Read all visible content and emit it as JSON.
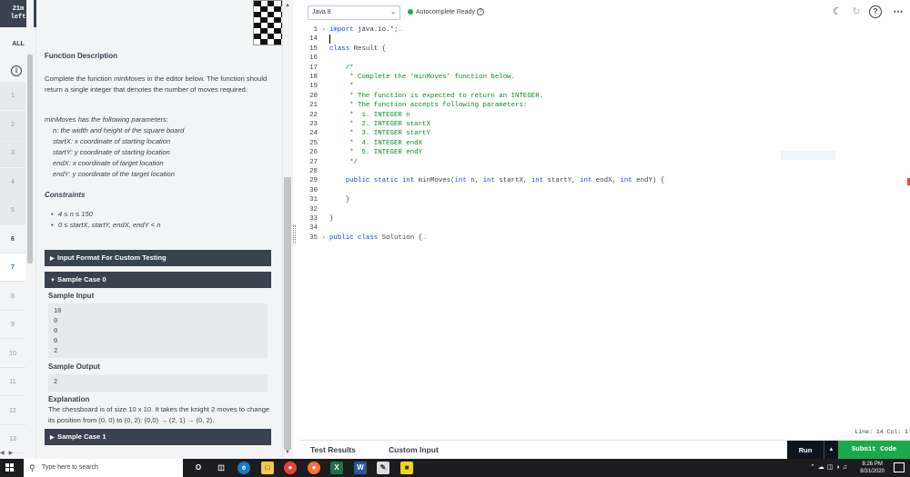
{
  "timer": {
    "line1": "21m",
    "line2": "left"
  },
  "rail": {
    "all_label": "ALL",
    "info_icon": "info-icon",
    "questions": [
      "1",
      "2",
      "3",
      "4",
      "5",
      "6",
      "7",
      "8",
      "9",
      "10",
      "11",
      "12",
      "13"
    ]
  },
  "problem": {
    "function_description_title": "Function Description",
    "desc_part1": "Complete the function ",
    "desc_fn": "minMoves",
    "desc_part2": " in the editor below. The function should return a single integer that denotes the number of moves required.",
    "params_intro": "minMoves has  the following parameters:",
    "params": [
      "n: the width and height of the square board",
      "startX: x coordinate of starting location",
      "startY: y coordinate of starting location",
      "endX: x coordinate of target location",
      "endY: y coordinate of the target location"
    ],
    "constraints_title": "Constraints",
    "constraints": [
      "4 ≤ n ≤ 150",
      "0 ≤ startX, startY, endX, endY < n"
    ],
    "input_format_label": "Input Format For Custom Testing",
    "sample_case_0_label": "Sample Case 0",
    "sample_input_title": "Sample Input",
    "sample_input": [
      "10",
      "0",
      "0",
      "0",
      "2"
    ],
    "sample_output_title": "Sample Output",
    "sample_output": "2",
    "explanation_title": "Explanation",
    "explanation": "The chessboard is of size 10 x 10.  It takes the knight 2 moves to change its position from (0, 0) to (0, 2): (0,0) → (2, 1) → (0, 2).",
    "sample_case_1_label": "Sample Case 1"
  },
  "editor": {
    "language": "Java 8",
    "autocomplete": "Autocomplete Ready",
    "status": "Line: 14 Col: 1",
    "lines": [
      {
        "n": "1",
        "fold": "›",
        "html": "<span class='kw'>import</span> java.io.*;<span class='dim'>…</span>"
      },
      {
        "n": "14",
        "fold": "",
        "html": ""
      },
      {
        "n": "15",
        "fold": "",
        "html": "<span class='kw'>class</span> Result {"
      },
      {
        "n": "16",
        "fold": "",
        "html": ""
      },
      {
        "n": "17",
        "fold": "",
        "html": "    <span class='cm'>/*</span>"
      },
      {
        "n": "18",
        "fold": "",
        "html": "<span class='cm'>     * Complete the 'minMoves' function below.</span>"
      },
      {
        "n": "19",
        "fold": "",
        "html": "<span class='cm'>     *</span>"
      },
      {
        "n": "20",
        "fold": "",
        "html": "<span class='cm'>     * The function is expected to return an INTEGER.</span>"
      },
      {
        "n": "21",
        "fold": "",
        "html": "<span class='cm'>     * The function accepts following parameters:</span>"
      },
      {
        "n": "22",
        "fold": "",
        "html": "<span class='cm'>     *  1. INTEGER n</span>"
      },
      {
        "n": "23",
        "fold": "",
        "html": "<span class='cm'>     *  2. INTEGER startX</span>"
      },
      {
        "n": "24",
        "fold": "",
        "html": "<span class='cm'>     *  3. INTEGER startY</span>"
      },
      {
        "n": "25",
        "fold": "",
        "html": "<span class='cm'>     *  4. INTEGER endX</span>"
      },
      {
        "n": "26",
        "fold": "",
        "html": "<span class='cm'>     *  5. INTEGER endY</span>"
      },
      {
        "n": "27",
        "fold": "",
        "html": "<span class='cm'>     */</span>"
      },
      {
        "n": "28",
        "fold": "",
        "html": ""
      },
      {
        "n": "29",
        "fold": "",
        "html": "    <span class='kw'>public static int</span> minMoves(<span class='kw'>int</span> n, <span class='kw'>int</span> startX, <span class='kw'>int</span> startY, <span class='kw'>int</span> endX, <span class='kw'>int</span> endY) {"
      },
      {
        "n": "30",
        "fold": "",
        "html": ""
      },
      {
        "n": "31",
        "fold": "",
        "html": "    }"
      },
      {
        "n": "32",
        "fold": "",
        "html": ""
      },
      {
        "n": "33",
        "fold": "",
        "html": "}"
      },
      {
        "n": "34",
        "fold": "",
        "html": ""
      },
      {
        "n": "35",
        "fold": "›",
        "html": "<span class='kw'>public class</span> Solution {<span class='dim'>…</span>"
      }
    ]
  },
  "bottom": {
    "test_results": "Test Results",
    "custom_input": "Custom Input",
    "run": "Run",
    "submit": "Submit Code"
  },
  "taskbar": {
    "search_placeholder": "Type here to search",
    "time": "8:26 PM",
    "date": "8/31/2020"
  },
  "colors": {
    "dark": "#39424e",
    "green": "#1ba94c",
    "keyword": "#1b44c9",
    "comment": "#0b8a28"
  }
}
